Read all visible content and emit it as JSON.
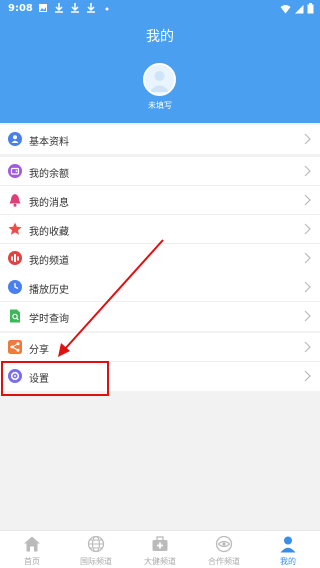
{
  "status_bar": {
    "time": "9:08"
  },
  "header": {
    "title": "我的",
    "username": "未填写"
  },
  "menu_groups": [
    [
      {
        "label": "基本资料",
        "icon": "person-icon",
        "color": "#4a7ff0"
      }
    ],
    [
      {
        "label": "我的余额",
        "icon": "wallet-icon",
        "color": "#a25ae0"
      },
      {
        "label": "我的消息",
        "icon": "bell-icon",
        "color": "#e0407a"
      },
      {
        "label": "我的收藏",
        "icon": "star-icon",
        "color": "#f04a4a"
      },
      {
        "label": "我的频道",
        "icon": "channel-icon",
        "color": "#e64040"
      }
    ],
    [
      {
        "label": "播放历史",
        "icon": "clock-icon",
        "color": "#4a7ff0"
      },
      {
        "label": "学时查询",
        "icon": "document-search-icon",
        "color": "#3cb85a"
      }
    ],
    [
      {
        "label": "分享",
        "icon": "share-icon",
        "color": "#f07a3c"
      },
      {
        "label": "设置",
        "icon": "gear-icon",
        "color": "#7a6ff0"
      }
    ]
  ],
  "tabs": [
    {
      "label": "首页",
      "icon": "home-icon",
      "active": false
    },
    {
      "label": "国际频道",
      "icon": "globe-icon",
      "active": false
    },
    {
      "label": "大健频道",
      "icon": "medkit-icon",
      "active": false
    },
    {
      "label": "合作频道",
      "icon": "eye-icon",
      "active": false
    },
    {
      "label": "我的",
      "icon": "user-icon",
      "active": true
    }
  ],
  "colors": {
    "header": "#4a9ff0",
    "active_tab": "#3b8ee8",
    "annotation": "#e01010"
  }
}
